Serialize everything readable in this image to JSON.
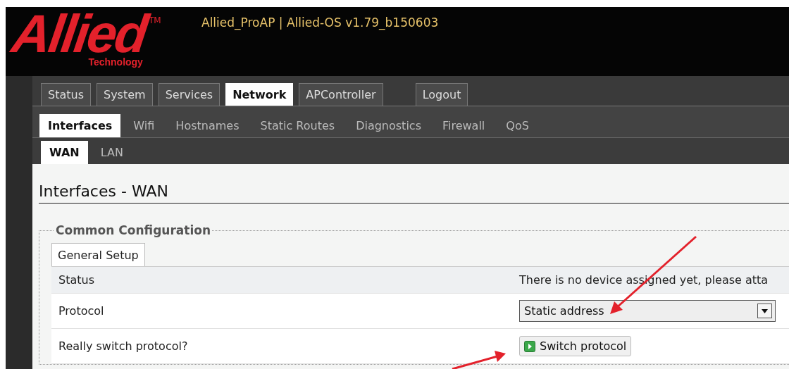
{
  "header": {
    "logo": {
      "wordmark": "Allied",
      "trademark": "TM",
      "tagline": "Technology"
    },
    "title": "Allied_ProAP | Allied-OS v1.79_b150603"
  },
  "nav": {
    "tabs": [
      {
        "label": "Status",
        "selected": false
      },
      {
        "label": "System",
        "selected": false
      },
      {
        "label": "Services",
        "selected": false
      },
      {
        "label": "Network",
        "selected": true
      },
      {
        "label": "APController",
        "selected": false
      }
    ],
    "logout": "Logout"
  },
  "subnav": {
    "items": [
      {
        "label": "Interfaces",
        "selected": true
      },
      {
        "label": "Wifi",
        "selected": false
      },
      {
        "label": "Hostnames",
        "selected": false
      },
      {
        "label": "Static Routes",
        "selected": false
      },
      {
        "label": "Diagnostics",
        "selected": false
      },
      {
        "label": "Firewall",
        "selected": false
      },
      {
        "label": "QoS",
        "selected": false
      }
    ]
  },
  "interface_tabs": [
    {
      "label": "WAN",
      "selected": true
    },
    {
      "label": "LAN",
      "selected": false
    }
  ],
  "page_title": "Interfaces - WAN",
  "section": {
    "legend": "Common Configuration",
    "tabs": [
      {
        "label": "General Setup",
        "selected": true
      }
    ],
    "rows": [
      {
        "label": "Status",
        "kind": "text",
        "value": "There is no device assigned yet, please atta"
      },
      {
        "label": "Protocol",
        "kind": "select",
        "value": "Static address"
      },
      {
        "label": "Really switch protocol?",
        "kind": "button",
        "value": "Switch protocol"
      }
    ]
  }
}
